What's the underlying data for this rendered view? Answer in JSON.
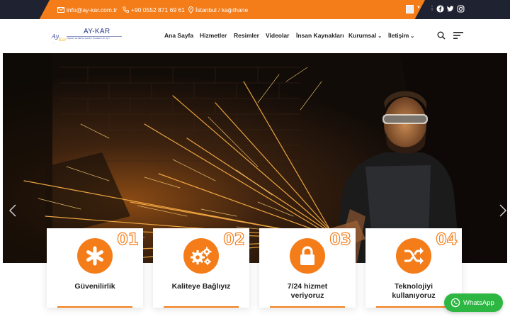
{
  "topbar": {
    "email": "info@ay-kar.com.tr",
    "phone": "+90 0552 871 69 61",
    "location": "İstanbul / kağıthane",
    "language_icon": "flag-icon",
    "social_icons": [
      "facebook-icon",
      "twitter-icon",
      "instagram-icon"
    ]
  },
  "brand": {
    "name": "AY-KAR",
    "logo_text_ay": "Ay",
    "logo_text_kar": "Kar",
    "tagline": "İNŞAAT VE METAL SANAYİ TİCARET LTD. ŞTİ."
  },
  "nav": {
    "items": [
      "Ana Sayfa",
      "Hizmetler",
      "Resimler",
      "Videolar",
      "İnsan Kaynakları",
      "Kurumsal",
      "İletişim"
    ]
  },
  "features": [
    {
      "number": "01",
      "title_line1": "Güvenilirlik",
      "title_line2": "",
      "icon": "asterisk-icon"
    },
    {
      "number": "02",
      "title_line1": "Kaliteye Bağlıyız",
      "title_line2": "",
      "icon": "gears-icon"
    },
    {
      "number": "03",
      "title_line1": "7/24 hizmet",
      "title_line2": "veriyoruz",
      "icon": "lock-icon"
    },
    {
      "number": "04",
      "title_line1": "Teknolojiyi",
      "title_line2": "kullanıyoruz",
      "icon": "shuffle-icon"
    }
  ],
  "whatsapp": {
    "label": "WhatsApp"
  },
  "colors": {
    "accent": "#f47d1a",
    "dark": "#1f2230",
    "whatsapp": "#2db742"
  }
}
